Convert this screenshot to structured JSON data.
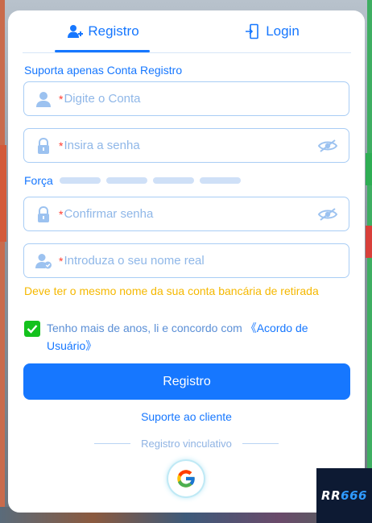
{
  "tabs": [
    {
      "label": "Registro"
    },
    {
      "label": "Login"
    }
  ],
  "form": {
    "hint": "Suporta apenas Conta Registro",
    "account_placeholder": "Digite o Conta",
    "password_placeholder": "Insira a senha",
    "strength_label": "Força",
    "confirm_placeholder": "Confirmar senha",
    "realname_placeholder": "Introduza o seu nome real",
    "required_mark": "*",
    "realname_warning": "Deve ter o mesmo nome da sua conta bancária de retirada",
    "agree_text": "Tenho mais de anos, li e concordo com ",
    "agree_link": "《Acordo de Usuário》",
    "agree_checked": true,
    "submit_label": "Registro",
    "support_label": "Suporte ao cliente",
    "bind_label": "Registro vinculativo"
  },
  "brand": {
    "part1": "RR",
    "part2": "666"
  },
  "colors": {
    "accent": "#1677ff",
    "warning": "#f5b800",
    "check": "#14c21d",
    "required": "#ff3b30"
  }
}
